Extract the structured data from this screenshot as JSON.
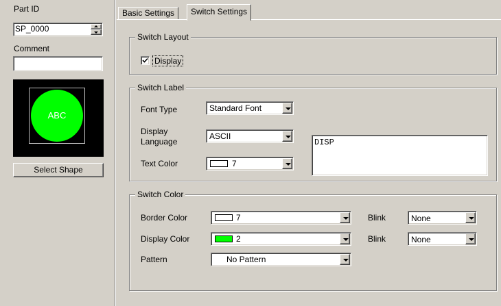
{
  "left_panel": {
    "part_id_label": "Part ID",
    "part_id_value": "SP_0000",
    "comment_label": "Comment",
    "comment_value": "",
    "preview_text": "ABC",
    "select_shape_label": "Select Shape"
  },
  "tabs": [
    {
      "label": "Basic Settings",
      "active": false
    },
    {
      "label": "Switch Settings",
      "active": true
    }
  ],
  "switch_layout": {
    "title": "Switch Layout",
    "display_label": "Display",
    "display_checked": true
  },
  "switch_label": {
    "title": "Switch Label",
    "font_type_label": "Font Type",
    "font_type_value": "Standard Font",
    "display_language_label_line1": "Display",
    "display_language_label_line2": "Language",
    "display_language_value": "ASCII",
    "text_color_label": "Text Color",
    "text_color_value": "7",
    "text_color_swatch": "#ffffff",
    "label_text": "DISP"
  },
  "switch_color": {
    "title": "Switch Color",
    "border_color_label": "Border Color",
    "border_color_value": "7",
    "border_color_swatch": "#ffffff",
    "display_color_label": "Display Color",
    "display_color_value": "2",
    "display_color_swatch": "#00ff00",
    "pattern_label": "Pattern",
    "pattern_value": "No Pattern",
    "blink1_label": "Blink",
    "blink1_value": "None",
    "blink2_label": "Blink",
    "blink2_value": "None"
  },
  "colors": {
    "face": "#d4d0c8",
    "preview_bg": "#000000",
    "preview_circle": "#00ff00"
  },
  "icons": [
    "spin-up-icon",
    "spin-down-icon",
    "checkbox-check-icon",
    "dropdown-arrow-icon"
  ]
}
